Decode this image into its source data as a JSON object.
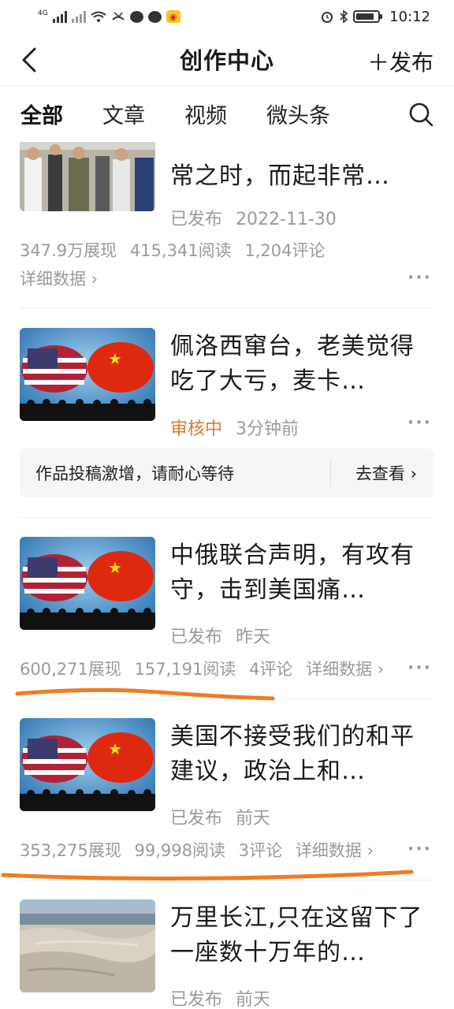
{
  "status_bar": {
    "network_tag": "4G",
    "time": "10:12"
  },
  "header": {
    "back_icon": "chevron-left-icon",
    "title": "创作中心",
    "publish_label": "＋发布"
  },
  "tabs": [
    {
      "label": "全部",
      "active": true
    },
    {
      "label": "文章",
      "active": false
    },
    {
      "label": "视频",
      "active": false
    },
    {
      "label": "微头条",
      "active": false
    }
  ],
  "items": [
    {
      "title": "常之时，而起非常…",
      "status": "已发布",
      "date": "2022-11-30",
      "views": "347.9万展现",
      "reads": "415,341阅读",
      "comments": "1,204评论",
      "detail": "详细数据 ›"
    },
    {
      "title": "佩洛西窜台，老美觉得吃了大亏，麦卡…",
      "status": "审核中",
      "date": "3分钟前",
      "notice": "作品投稿激增，请耐心等待",
      "notice_action": "去查看 ›"
    },
    {
      "title": "中俄联合声明，有攻有守，击到美国痛…",
      "status": "已发布",
      "date": "昨天",
      "views": "600,271展现",
      "reads": "157,191阅读",
      "comments": "4评论",
      "detail": "详细数据 ›"
    },
    {
      "title": "美国不接受我们的和平建议，政治上和…",
      "status": "已发布",
      "date": "前天",
      "views": "353,275展现",
      "reads": "99,998阅读",
      "comments": "3评论",
      "detail": "详细数据 ›"
    },
    {
      "title": "万里长江,只在这留下了一座数十万年的…",
      "status": "已发布",
      "date": "前天"
    }
  ],
  "more_label": "···",
  "colors": {
    "review": "#e07a2e",
    "meta": "#9a9a9a",
    "annotation": "#f07b23"
  }
}
